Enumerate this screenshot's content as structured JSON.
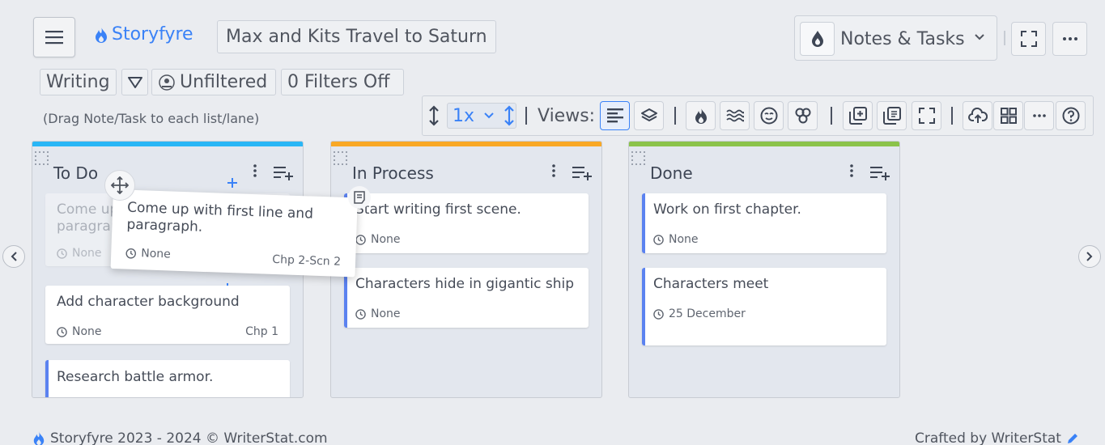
{
  "header": {
    "brand": "Storyfyre",
    "project_title": "Max and Kits Travel to Saturn",
    "notes_selector": "Notes & Tasks"
  },
  "filters": {
    "mode": "Writing",
    "status": "Unfiltered",
    "filters_off": "0 Filters Off",
    "hint": "(Drag Note/Task to each list/lane)"
  },
  "toolbar": {
    "zoom": "1x",
    "views_label": "Views:"
  },
  "columns": [
    {
      "title": "To Do",
      "color": "#29b6f6",
      "cards": [
        {
          "title": "Come up with first line and paragraph.",
          "date": "None",
          "chapter": ""
        },
        {
          "title": "Add character background",
          "date": "None",
          "chapter": "Chp 1"
        },
        {
          "title": "Research battle armor.",
          "date": "",
          "chapter": ""
        }
      ]
    },
    {
      "title": "In Process",
      "color": "#f9a825",
      "cards": [
        {
          "title": "Start writing first scene.",
          "date": "None",
          "chapter": ""
        },
        {
          "title": "Characters hide in gigantic ship",
          "date": "None",
          "chapter": ""
        }
      ]
    },
    {
      "title": "Done",
      "color": "#8bc34a",
      "cards": [
        {
          "title": "Work on first chapter.",
          "date": "None",
          "chapter": ""
        },
        {
          "title": "Characters meet",
          "date": "25 December",
          "chapter": ""
        }
      ]
    }
  ],
  "dragging": {
    "title": "Come up with first line and paragraph.",
    "date": "None",
    "chapter": "Chp 2-Scn 2"
  },
  "footer": {
    "left": "Storyfyre 2023 - 2024 ©  WriterStat.com",
    "right": "Crafted by WriterStat"
  }
}
